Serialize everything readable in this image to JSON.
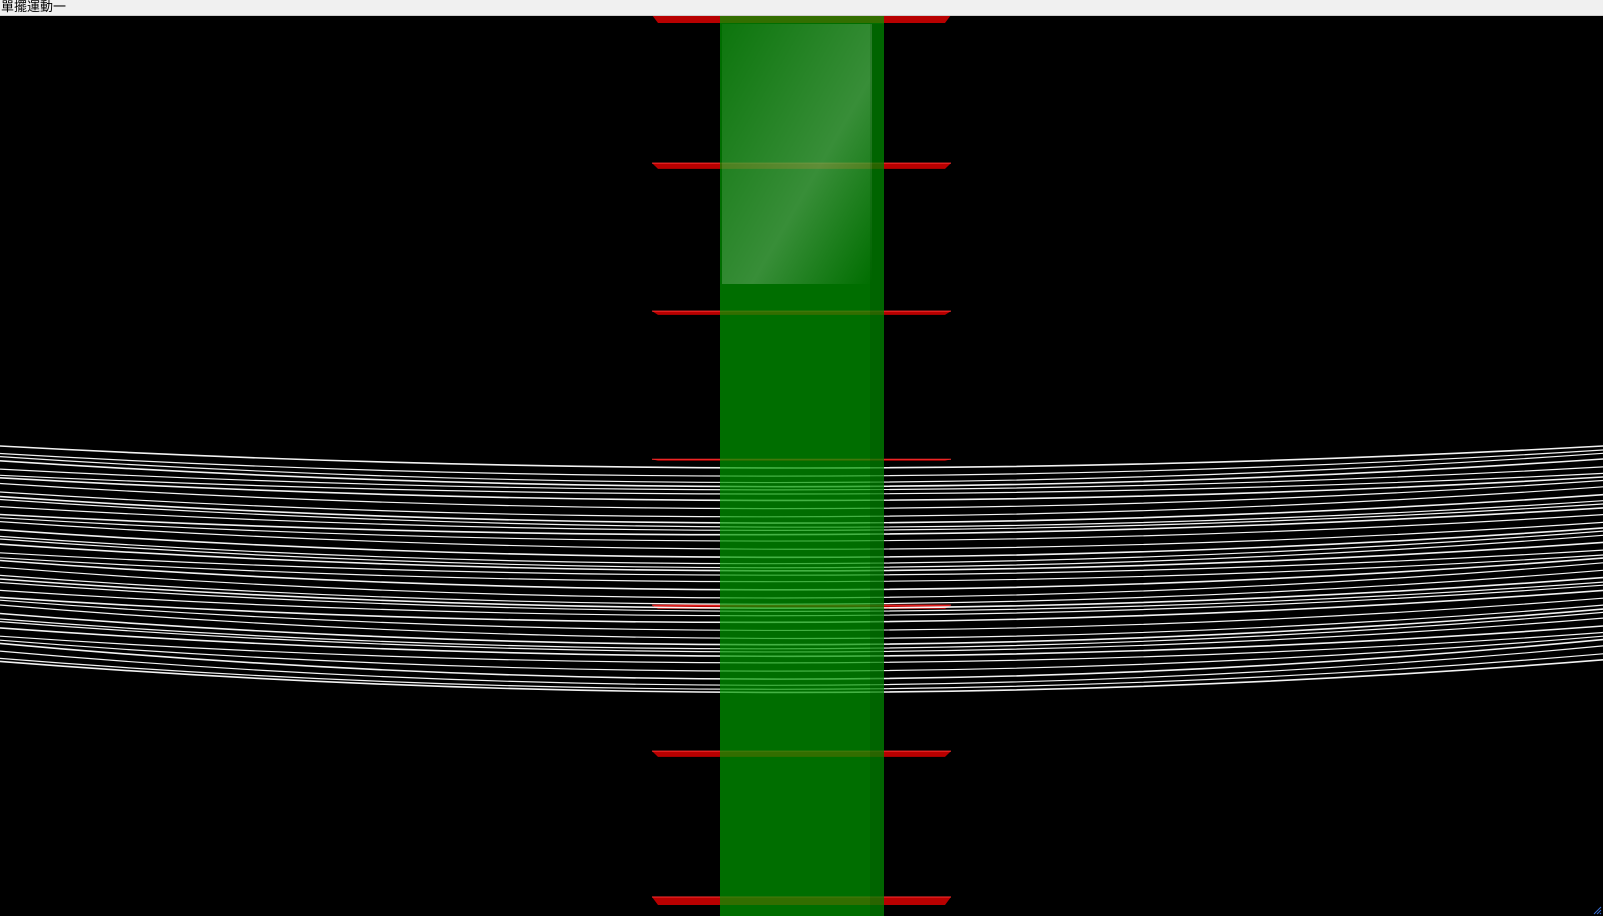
{
  "window": {
    "title": "單擺運動一"
  },
  "scene": {
    "background_color": "#000000",
    "pendulum_color": "#009900",
    "marker_color": "#cc0000",
    "string_color": "#ffffff",
    "marker_count": 7,
    "string_count": 40
  },
  "icons": {
    "resize_grip": "resize-grip-icon"
  }
}
